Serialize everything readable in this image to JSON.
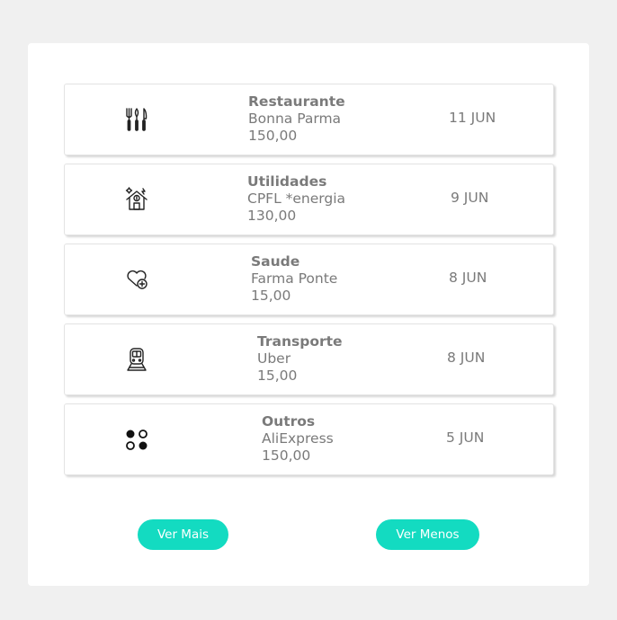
{
  "transactions": [
    {
      "category": "Restaurante",
      "merchant": "Bonna Parma",
      "amount": "150,00",
      "date": "11 JUN",
      "icon": "cutlery-icon"
    },
    {
      "category": "Utilidades",
      "merchant": "CPFL *energia",
      "amount": "130,00",
      "date": "9 JUN",
      "icon": "house-utilities-icon"
    },
    {
      "category": "Saude",
      "merchant": "Farma Ponte",
      "amount": "15,00",
      "date": "8 JUN",
      "icon": "heart-health-icon"
    },
    {
      "category": "Transporte",
      "merchant": "Uber",
      "amount": "15,00",
      "date": "8 JUN",
      "icon": "train-icon"
    },
    {
      "category": "Outros",
      "merchant": "AliExpress",
      "amount": "150,00",
      "date": "5 JUN",
      "icon": "dots-icon"
    }
  ],
  "buttons": {
    "more": "Ver Mais",
    "less": "Ver Menos"
  },
  "colors": {
    "accent": "#13dbc1",
    "text": "#7a7a7a",
    "background": "#f0f0f0"
  }
}
